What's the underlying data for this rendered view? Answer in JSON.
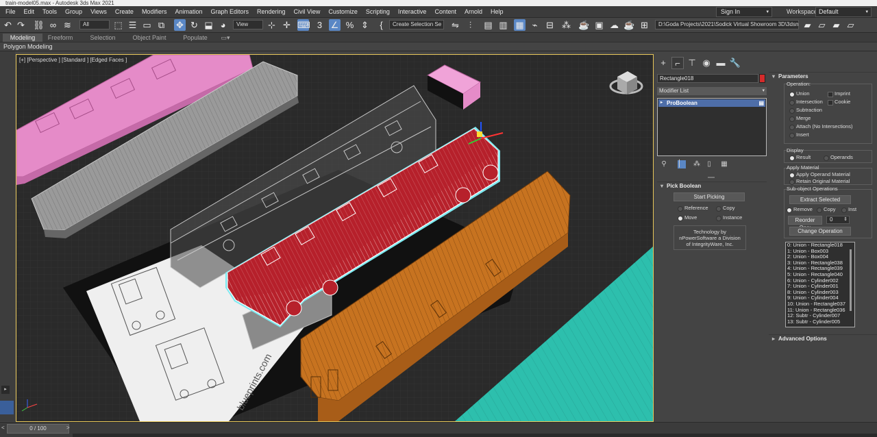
{
  "app": {
    "title": "train-model05.max - Autodesk 3ds Max 2021"
  },
  "menubar": {
    "items": [
      "File",
      "Edit",
      "Tools",
      "Group",
      "Views",
      "Create",
      "Modifiers",
      "Animation",
      "Graph Editors",
      "Rendering",
      "Civil View",
      "Customize",
      "Scripting",
      "Interactive",
      "Content",
      "Arnold",
      "Help"
    ],
    "sign_in": "Sign In",
    "workspaces_label": "Workspaces:",
    "workspace_value": "Default"
  },
  "toolbar": {
    "selection_filter": "All",
    "coord_system": "View",
    "named_selection": "Create Selection Se",
    "project_path": "D:\\Goda Projects\\2021\\Sodick Virtual Showroom 3D\\3dsmax"
  },
  "ribbon": {
    "tabs": [
      "Modeling",
      "Freeform",
      "Selection",
      "Object Paint",
      "Populate"
    ],
    "active_tab": "Modeling",
    "panel_label": "Polygon Modeling"
  },
  "viewport": {
    "label": "[+] [Perspective ] [Standard ] [Edged Faces ]"
  },
  "command_panel": {
    "object_name": "Rectangle018",
    "object_color": "#d42b2b",
    "modifier_list": "Modifier List",
    "stack": [
      "ProBoolean"
    ],
    "pick_boolean": {
      "title": "Pick Boolean",
      "start_picking": "Start Picking",
      "reference": "Reference",
      "copy": "Copy",
      "move": "Move",
      "instance": "Instance",
      "tech": [
        "Technology by",
        "nPowerSoftware a Division",
        "of IntegrityWare, Inc."
      ]
    },
    "parameters": {
      "title": "Parameters",
      "operation_label": "Operation:",
      "union": "Union",
      "intersection": "Intersection",
      "subtraction": "Subtraction",
      "merge": "Merge",
      "attach": "Attach (No Intersections)",
      "insert": "Insert",
      "imprint": "Imprint",
      "cookie": "Cookie",
      "display_label": "Display",
      "result": "Result",
      "operands": "Operands",
      "apply_material_label": "Apply Material",
      "apply_operand_material": "Apply Operand Material",
      "retain_original_material": "Retain Original Material",
      "subobject_label": "Sub-object Operations",
      "extract_selected": "Extract Selected",
      "remove": "Remove",
      "copy": "Copy",
      "inst": "Inst",
      "reorder_ops": "Reorder Ops:",
      "reorder_value": "0",
      "change_operation": "Change Operation",
      "operations": [
        "0: Union - Rectangle018",
        "1: Union - Box003",
        "2: Union - Box004",
        "3: Union - Rectangle038",
        "4: Union - Rectangle039",
        "5: Union - Rectangle040",
        "6: Union - Cylinder002",
        "7: Union - Cylinder001",
        "8: Union - Cylinder003",
        "9: Union - Cylinder004",
        "10: Union - Rectangle037",
        "11: Union - Rectangle036",
        "12: Subtr - Cylinder007",
        "13: Subtr - Cylinder005"
      ]
    },
    "advanced_options": "Advanced Options"
  },
  "timeline": {
    "frame": "0 / 100"
  },
  "colors": {
    "accent": "#5a87c5",
    "viewport_border": "#e9c85a",
    "selected_train": "#b7212b",
    "orange_train": "#c77320",
    "pink_train": "#e58bc8",
    "teal_floor": "#2dbfad"
  }
}
